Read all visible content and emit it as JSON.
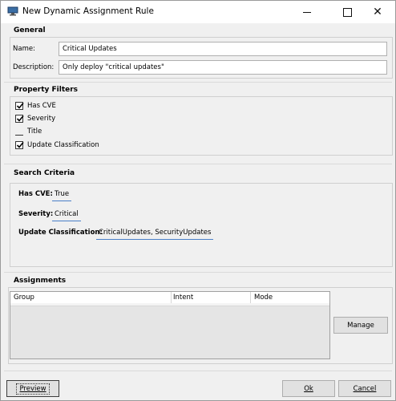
{
  "window": {
    "title": "New Dynamic Assignment Rule"
  },
  "general": {
    "title": "General",
    "name_label": "Name:",
    "name_value": "Critical Updates",
    "description_label": "Description:",
    "description_value": "Only deploy \"critical updates\""
  },
  "property_filters": {
    "title": "Property Filters",
    "items": [
      {
        "label": "Has CVE",
        "checked": true
      },
      {
        "label": "Severity",
        "checked": true
      },
      {
        "label": "Title",
        "checked": false
      },
      {
        "label": "Update Classification",
        "checked": true
      }
    ]
  },
  "search_criteria": {
    "title": "Search Criteria",
    "rows": [
      {
        "label": "Has CVE:",
        "value": "True"
      },
      {
        "label": "Severity:",
        "value": "Critical"
      },
      {
        "label": "Update Classification:",
        "value": "CriticalUpdates, SecurityUpdates"
      }
    ]
  },
  "assignments": {
    "title": "Assignments",
    "columns": [
      "Group",
      "Intent",
      "Mode"
    ],
    "manage_label": "Manage"
  },
  "footer": {
    "preview_label": "Preview",
    "ok_label": "Ok",
    "cancel_label": "Cancel"
  },
  "colors": {
    "accent_underline": "#4a7fc8",
    "background": "#f0f0f0"
  }
}
